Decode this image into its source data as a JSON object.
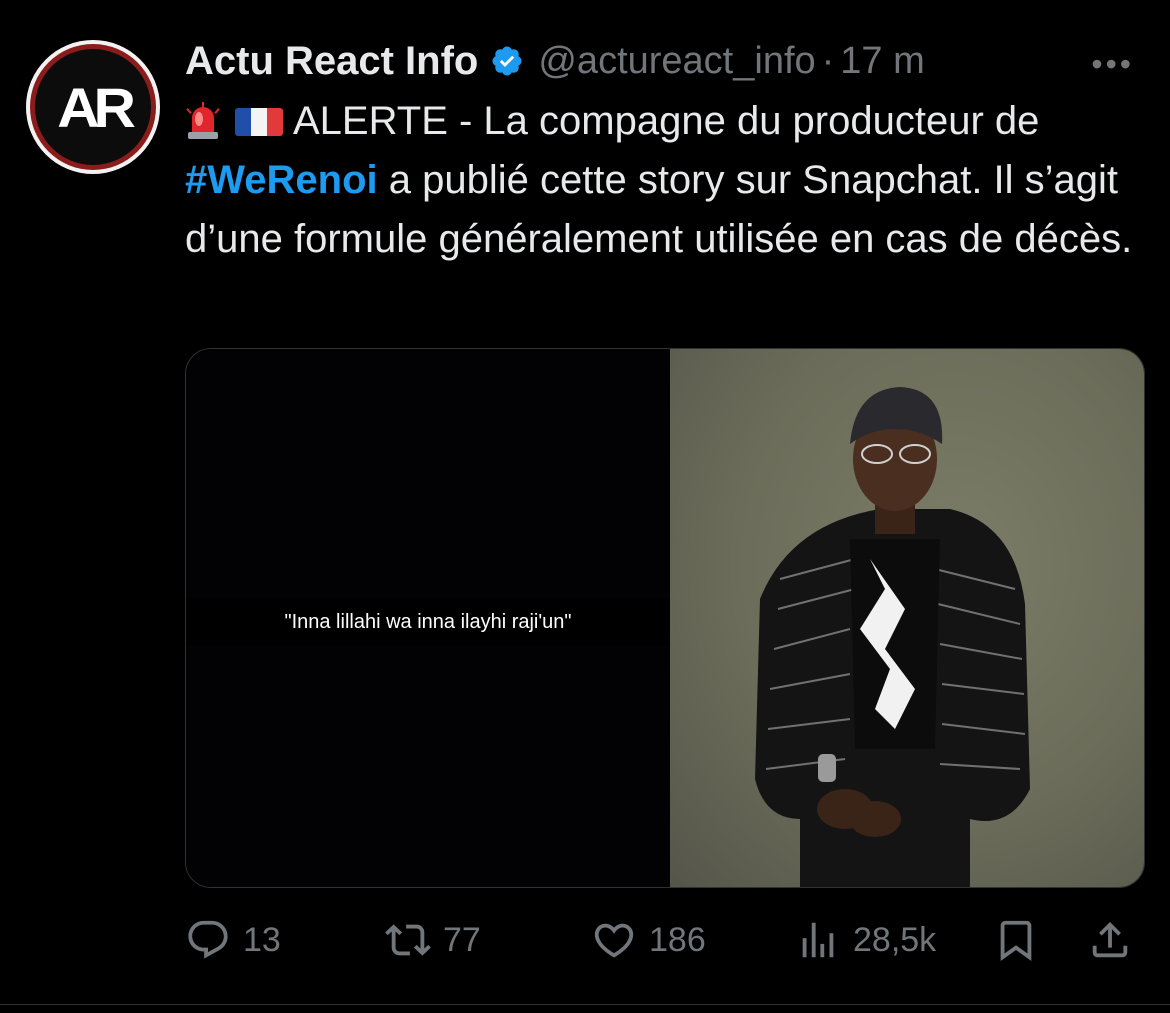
{
  "author": {
    "avatar_text": "AR",
    "display_name": "Actu React Info",
    "handle": "@actureact_info",
    "time": "17 m",
    "verified_color": "#1d9bf0"
  },
  "more_label": "•••",
  "tweet": {
    "text_part1": "ALERTE - La compagne du producteur de",
    "hashtag": "#WeRenoi",
    "text_part2": " a publié cette story sur Snapchat. Il s’agit d’une formule généralement utilisée en cas de décès."
  },
  "media": {
    "left_caption": "\"Inna lillahi wa inna ilayhi raji'un\""
  },
  "actions": {
    "replies": "13",
    "retweets": "77",
    "likes": "186",
    "views": "28,5k"
  },
  "colors": {
    "accent": "#1d9bf0",
    "muted": "#71767b",
    "text": "#e7e9ea",
    "background": "#000000"
  }
}
